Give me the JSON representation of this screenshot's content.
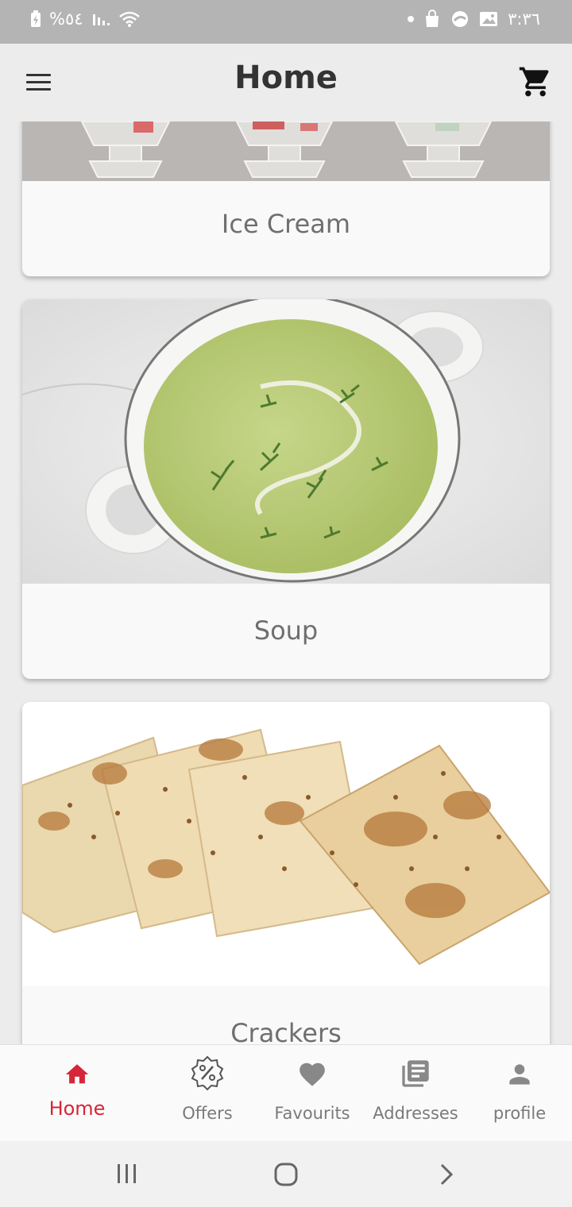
{
  "status_bar": {
    "battery": "%٥٤",
    "signal_icon": "signal-icon",
    "wifi_icon": "wifi-icon",
    "time": "٣:٣٦"
  },
  "app_bar": {
    "title": "Home",
    "menu_icon": "menu-icon",
    "cart_icon": "cart-icon"
  },
  "categories": [
    {
      "label": "Ice Cream"
    },
    {
      "label": "Soup"
    },
    {
      "label": "Crackers"
    }
  ],
  "bottom_nav": {
    "active_color": "#d6263a",
    "items": [
      {
        "label": "Home",
        "icon": "home-icon",
        "active": true
      },
      {
        "label": "Offers",
        "icon": "offers-percent-icon",
        "active": false
      },
      {
        "label": "Favourits",
        "icon": "heart-icon",
        "active": false
      },
      {
        "label": "Addresses",
        "icon": "addresses-icon",
        "active": false
      },
      {
        "label": "profile",
        "icon": "person-icon",
        "active": false
      }
    ]
  },
  "system_nav": {
    "recents_icon": "recents-icon",
    "home_icon": "system-home-icon",
    "back_icon": "back-icon"
  }
}
